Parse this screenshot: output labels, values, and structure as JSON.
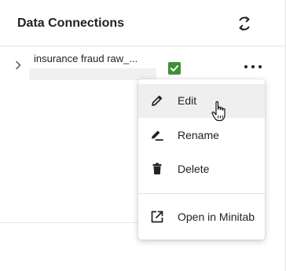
{
  "header": {
    "title": "Data Connections",
    "refresh_icon": "refresh-icon"
  },
  "connection": {
    "name": "insurance fraud raw_...",
    "expand_icon": "chevron-right-icon",
    "status_icon": "check-icon",
    "status_color": "#3f8f3a",
    "more_icon": "more-horizontal-icon"
  },
  "context_menu": {
    "items": [
      {
        "label": "Edit",
        "icon": "pencil-icon",
        "active": true
      },
      {
        "label": "Rename",
        "icon": "rename-pencil-icon",
        "active": false
      },
      {
        "label": "Delete",
        "icon": "trash-icon",
        "active": false
      },
      {
        "label": "Open in Minitab",
        "icon": "open-external-icon",
        "active": false
      }
    ]
  },
  "cursor": "hand-pointer-icon"
}
